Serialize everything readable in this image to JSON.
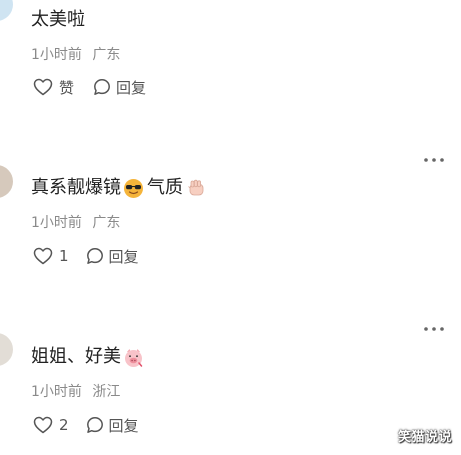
{
  "comments": [
    {
      "text": "太美啦",
      "time": "1小时前",
      "location": "广东",
      "like_label": "赞",
      "reply_label": "回复"
    },
    {
      "text": "真系靓爆镜",
      "text_after_emoji": "气质",
      "emojis": [
        "sunglasses-face-emoji",
        "raised-fist-emoji"
      ],
      "time": "1小时前",
      "location": "广东",
      "like_count": "1",
      "reply_label": "回复"
    },
    {
      "text": "姐姐、好美",
      "emojis": [
        "pig-face-emoji"
      ],
      "time": "1小时前",
      "location": "浙江",
      "like_count": "2",
      "reply_label": "回复"
    }
  ],
  "watermark": "笑猫说说"
}
